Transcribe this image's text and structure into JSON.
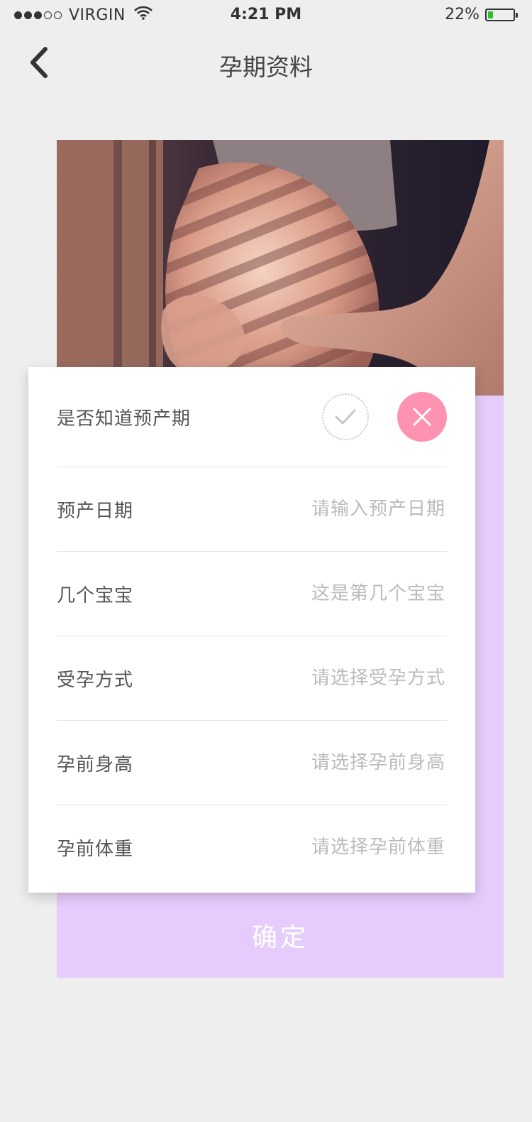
{
  "status_bar": {
    "carrier": "VIRGIN",
    "time": "4:21 PM",
    "battery": "22%",
    "battery_level": 0.22,
    "signal_bars": 3,
    "signal_total": 5
  },
  "nav": {
    "title": "孕期资料",
    "back_icon": "chevron-left-icon"
  },
  "hero": {
    "image": "pregnant-belly-photo"
  },
  "form": {
    "due_known": {
      "label": "是否知道预产期",
      "yes_icon": "check-icon",
      "no_icon": "close-icon",
      "selected": "no",
      "accent": "#fe92b1"
    },
    "fields": [
      {
        "key": "due_date",
        "label": "预产日期",
        "placeholder": "请输入预产日期",
        "value": ""
      },
      {
        "key": "baby_count",
        "label": "几个宝宝",
        "placeholder": "这是第几个宝宝",
        "value": ""
      },
      {
        "key": "conception",
        "label": "受孕方式",
        "placeholder": "请选择受孕方式",
        "value": ""
      },
      {
        "key": "height",
        "label": "孕前身高",
        "placeholder": "请选择孕前身高",
        "value": ""
      },
      {
        "key": "weight",
        "label": "孕前体重",
        "placeholder": "请选择孕前体重",
        "value": ""
      }
    ]
  },
  "confirm": {
    "label": "确定",
    "background": "#e6ccfc"
  }
}
